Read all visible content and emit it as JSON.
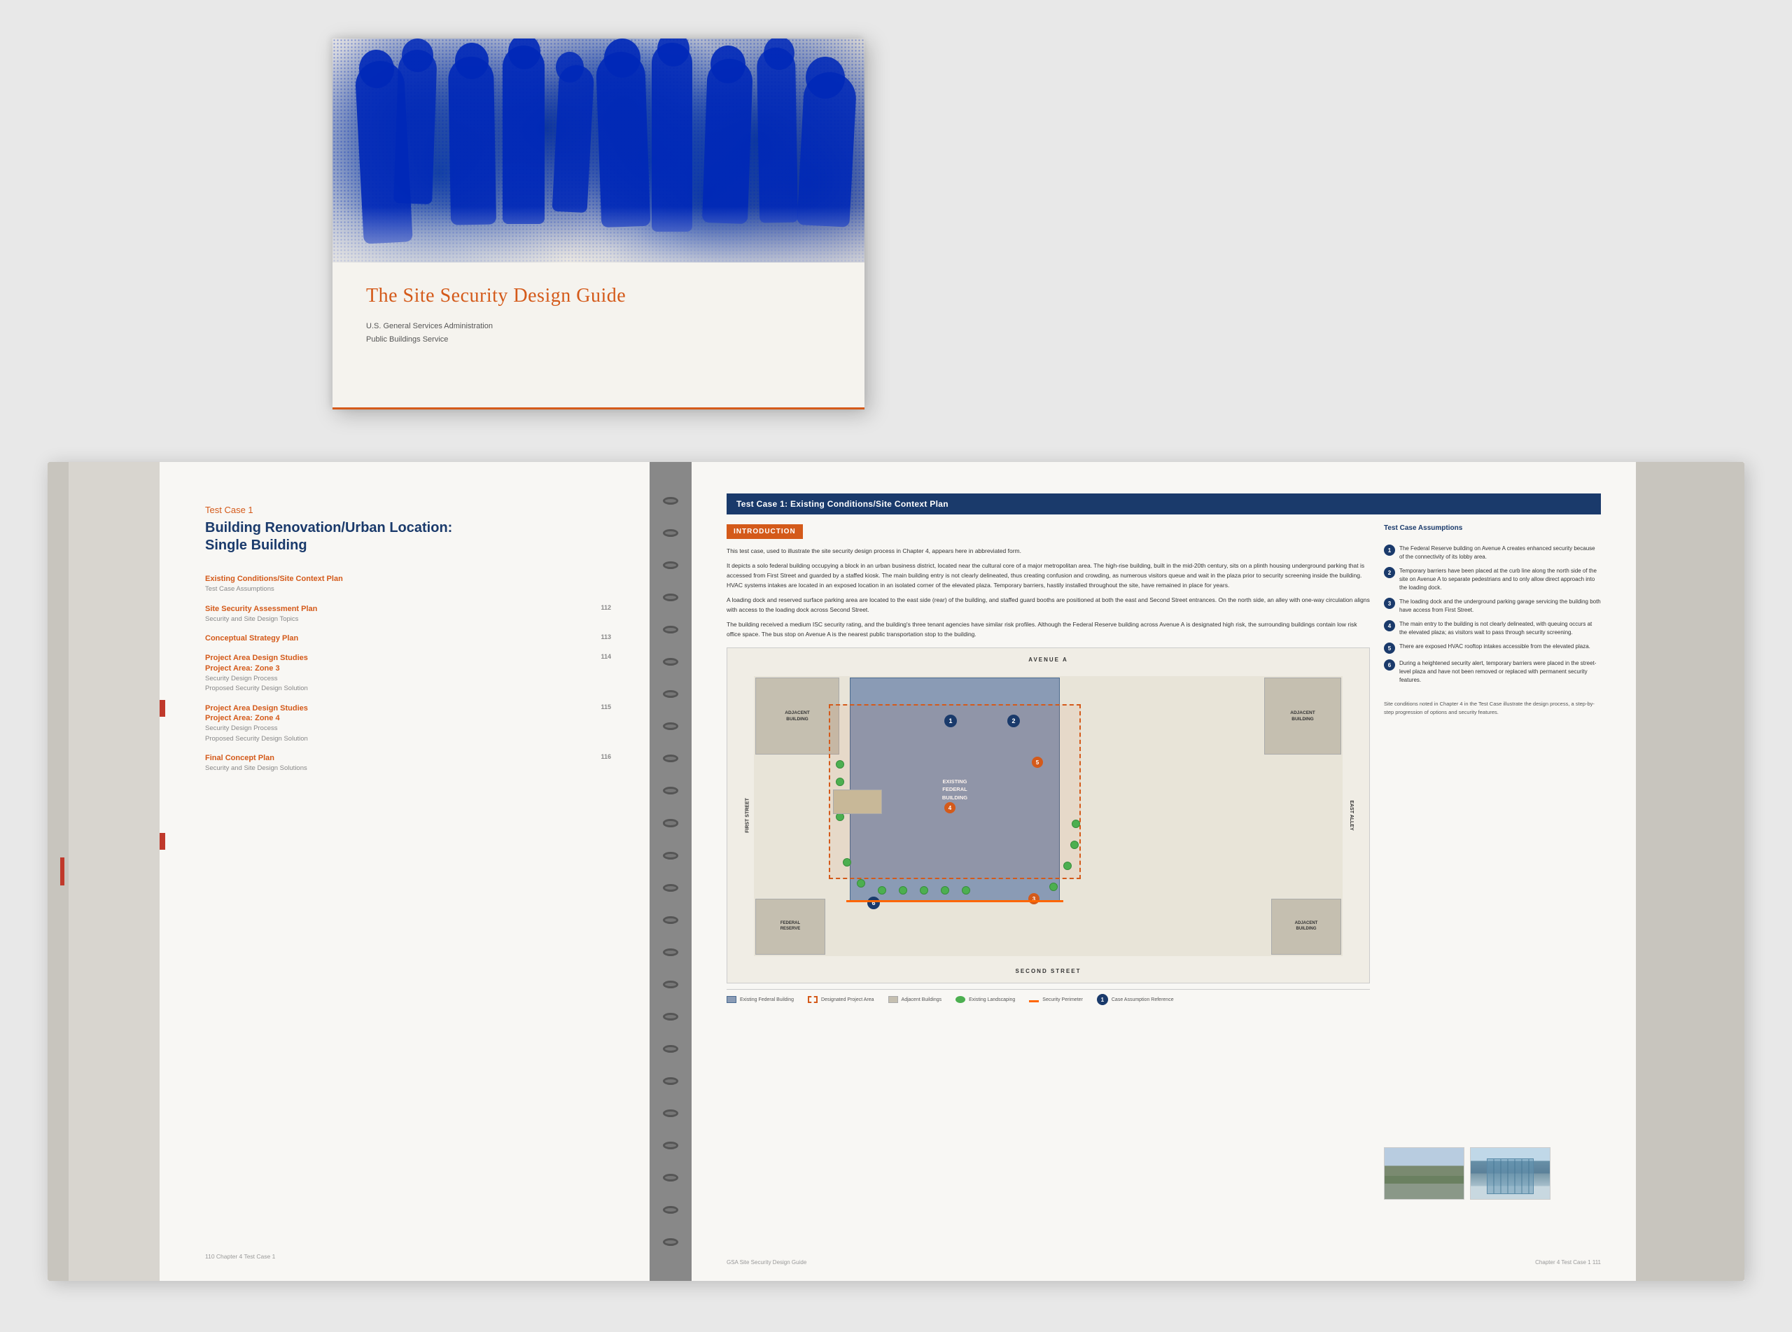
{
  "page": {
    "background_color": "#e8e8e8"
  },
  "cover": {
    "title": "The Site Security Design Guide",
    "subtitle_line1": "U.S. General Services Administration",
    "subtitle_line2": "Public Buildings Service"
  },
  "open_book": {
    "left_page": {
      "section_label": "Test Case 1",
      "section_title_line1": "Building Renovation/Urban Location:",
      "section_title_line2": "Single Building",
      "toc_items": [
        {
          "title": "Existing Conditions/Site Context Plan",
          "sub": "Test Case Assumptions",
          "number": ""
        },
        {
          "title": "Site Security Assessment Plan",
          "sub": "Security and Site Design Topics",
          "number": "112"
        },
        {
          "title": "Conceptual Strategy Plan",
          "sub": "",
          "number": "113"
        },
        {
          "title": "Project Area Design Studies\nProject Area: Zone 3",
          "sub": "Security Design Process\nProposed Security Design Solution",
          "number": "114"
        },
        {
          "title": "Project Area Design Studies\nProject Area: Zone 4",
          "sub": "Security Design Process\nProposed Security Design Solution",
          "number": "115"
        },
        {
          "title": "Final Concept Plan",
          "sub": "Security and Site Design Solutions",
          "number": "116"
        }
      ],
      "footer": "110  Chapter 4  Test Case 1"
    },
    "right_page": {
      "header": "Test Case 1: Existing Conditions/Site Context Plan",
      "intro_label": "INTRODUCTION",
      "intro_paragraphs": [
        "This test case, used to illustrate the site security design process in Chapter 4, appears here in abbreviated form.",
        "It depicts a solo federal building occupying a block in an urban business district, located near the cultural core of a major metropolitan area. The high-rise building, built in the mid-20th century sits on a plinth housing underground parking that is accessed from First Street and guarded by a staffed kiosk. The main building entry is not clearly delineated, thus creating confusion and crowding, as numerous visitors queue and wait in the plaza prior to security screening inside the building. HVAC systems intakes are located in an exposed location in an isolated corner of the elevated plaza. Temporary barriers, hastily installed throughout the site, have remained in place for years.",
        "A loading dock and reserved surface parking area are located to the east side (rear) of the building, and staffed guard booths are positioned at both the east and Second Street entrances. On the north side, an alley with one-way circulation aligns with access to the loading dock across Second Street.",
        "The building received a medium ISC security rating, and the building's three tenant agencies have similar risk profiles. Although the Federal Reserve building across Avenue A is designated high risk, the surrounding buildings contain low risk office space. The bus stop on Avenue A is the nearest public transportation stop to the building."
      ],
      "case_assumptions_title": "Test Case Assumptions",
      "assumptions": [
        {
          "num": "1",
          "text": "The Federal Reserve building on Avenue A creates enhanced security because of the connectivity of its lobby area."
        },
        {
          "num": "2",
          "text": "Temporary barriers have been placed at the curb line along the north side of the site on Avenue A to separate pedestrians and to only allow direct approach into the loading dock."
        },
        {
          "num": "3",
          "text": "The loading dock and the underground parking garage service the building both have access from First Street."
        },
        {
          "num": "4",
          "text": "The main entry to the building is not clearly delineated, with queuing occurs at the elevated plaza; as visitors wait to pass through security screening."
        },
        {
          "num": "5",
          "text": "There are exposed HVAC rooftop intakes accessible from the elevated plaza."
        },
        {
          "num": "6",
          "text": "During a heightened security alert, temporary barriers were placed in the street-level plaza and have not been removed or replaced with permanent security features."
        }
      ],
      "map_labels": {
        "avenue_a": "AVENUE A",
        "first_street": "FIRST STREET",
        "second_street": "SECOND STREET",
        "existing_building": "EXISTING FEDERAL BUILDING",
        "project_area": "DESIGNATED PROJECT AREA"
      },
      "footer_left": "GSA Site Security Design Guide",
      "footer_right": "Chapter 4  Test Case 1  111"
    }
  }
}
